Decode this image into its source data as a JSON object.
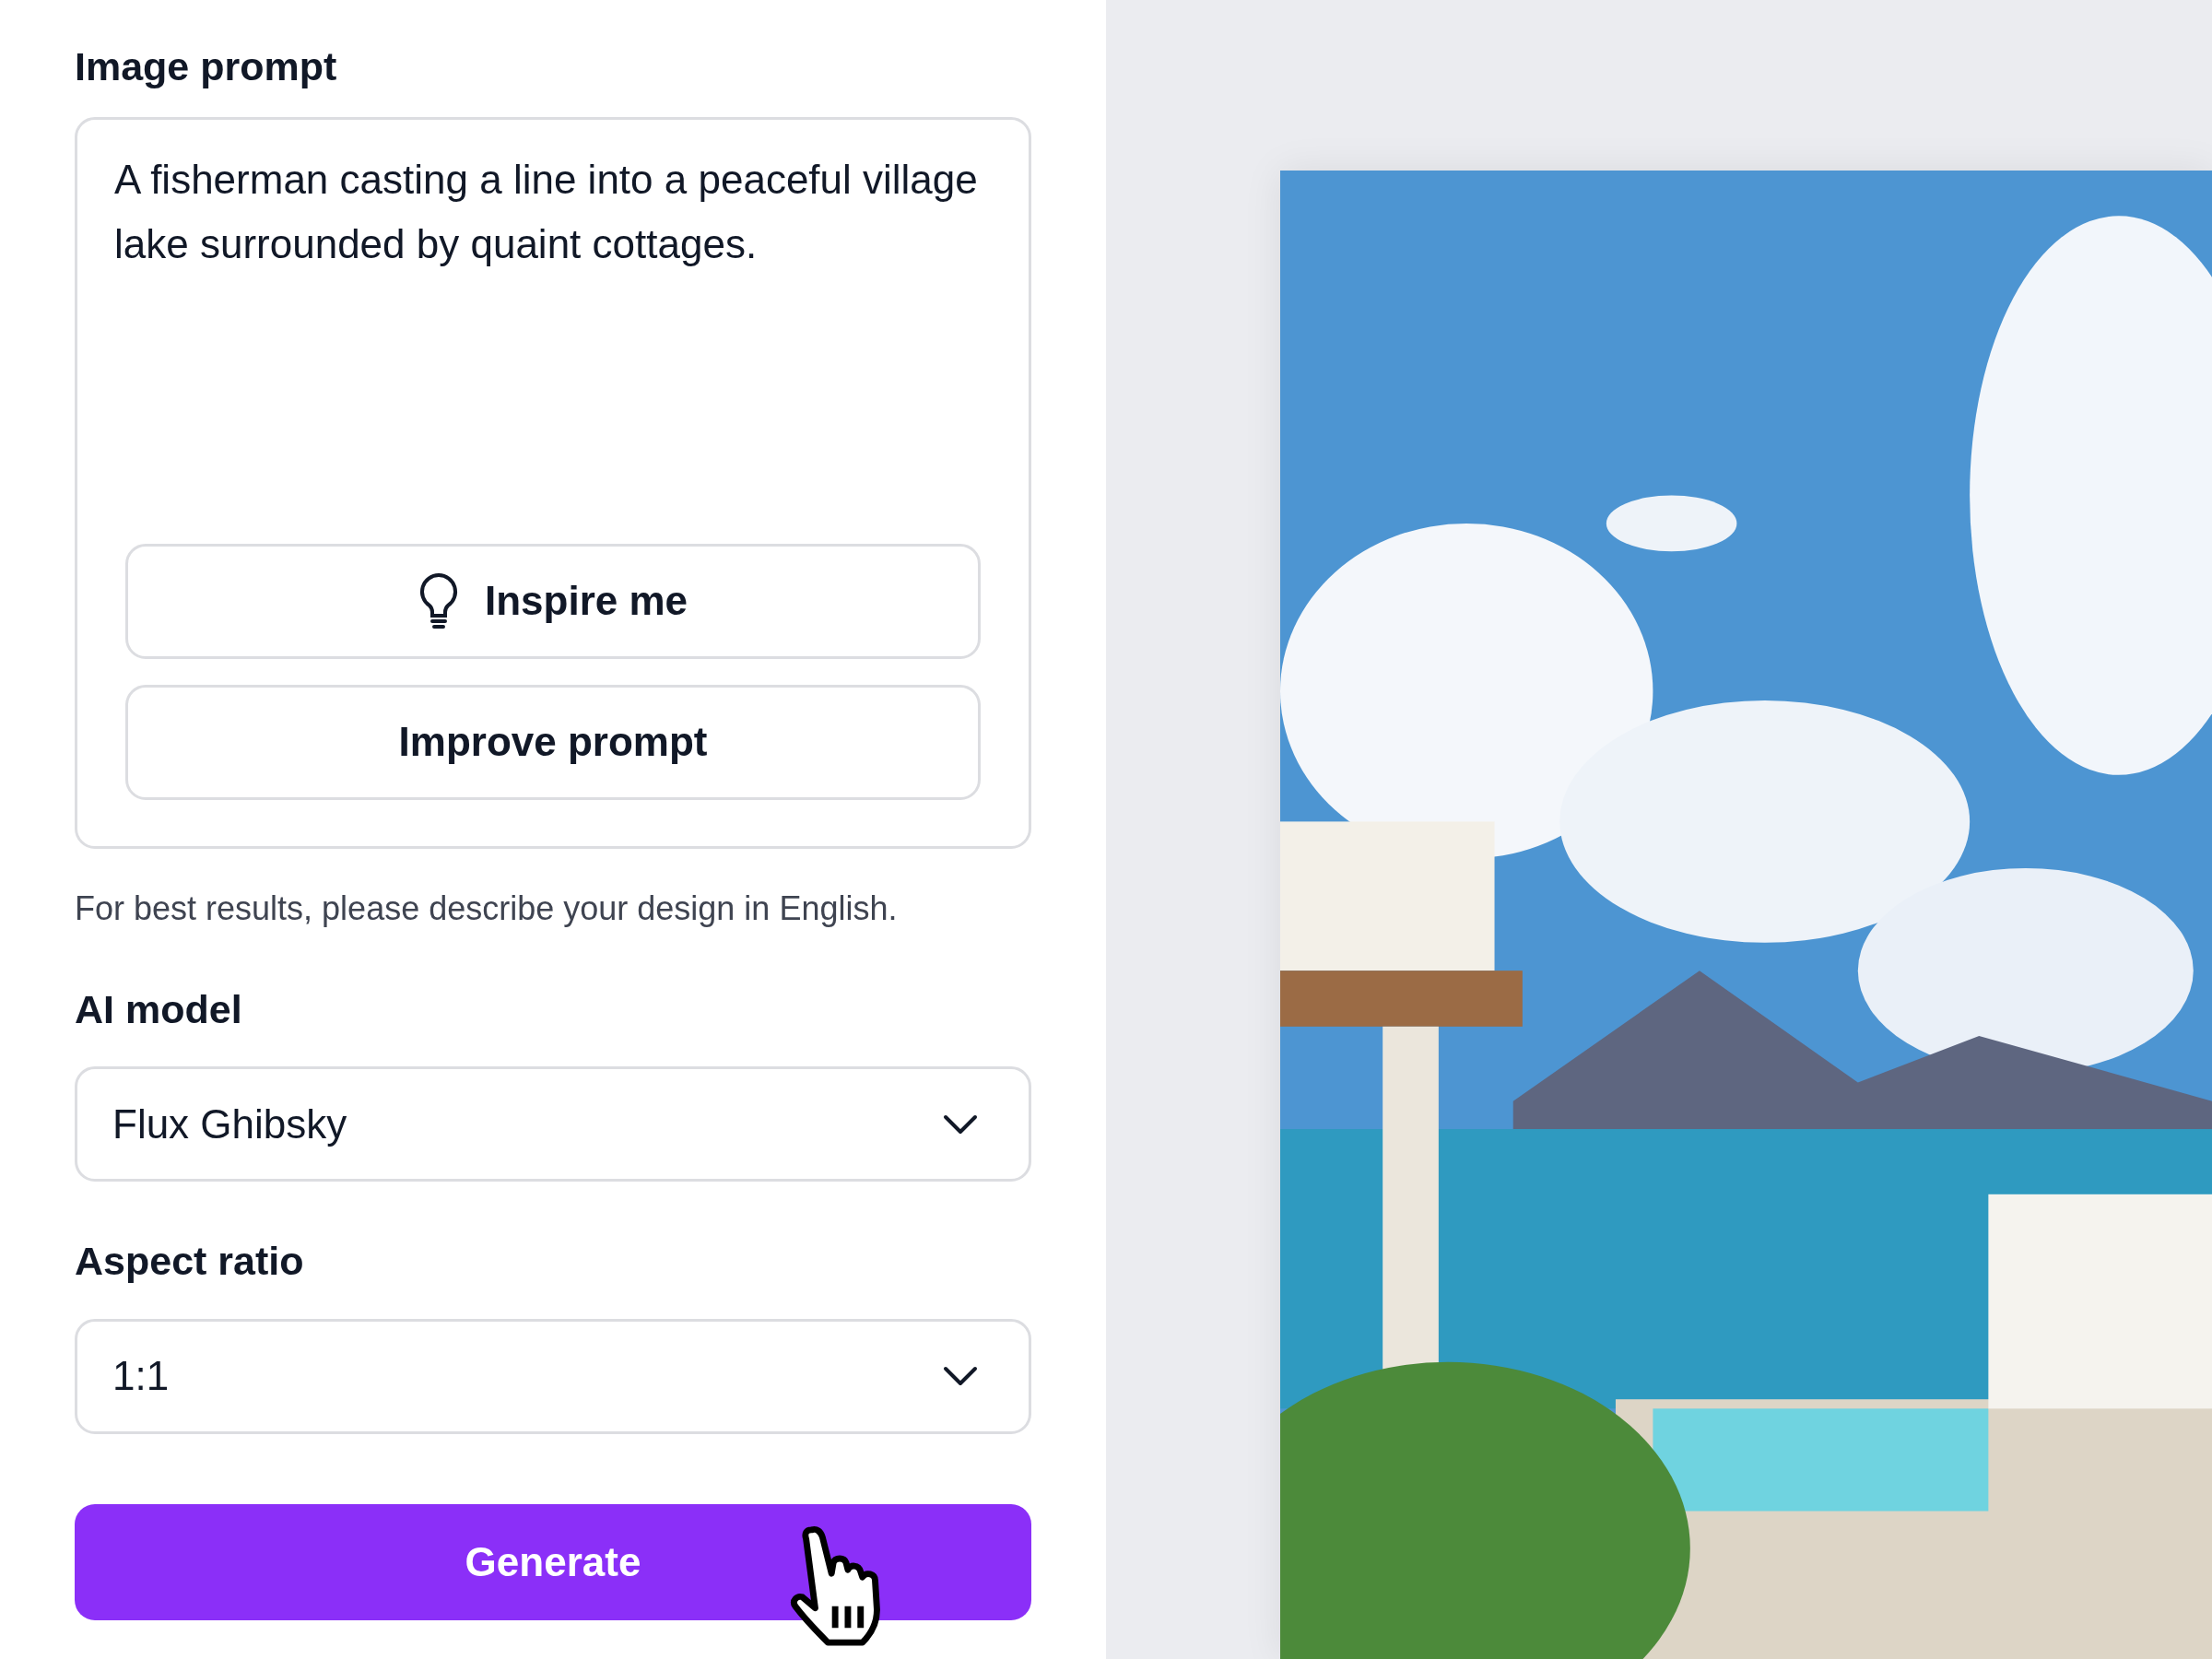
{
  "prompt_section": {
    "label": "Image prompt",
    "value": "A fisherman casting a line into a peaceful village lake surrounded by quaint cottages.",
    "buttons": [
      {
        "kind": "inspire",
        "label": "Inspire me"
      },
      {
        "kind": "improve",
        "label": "Improve prompt"
      }
    ],
    "hint": "For best results, please describe your design in English."
  },
  "selects": [
    {
      "label": "AI model",
      "value": "Flux Ghibsky"
    },
    {
      "label": "Aspect ratio",
      "value": "1:1"
    }
  ],
  "generate_button": {
    "label": "Generate"
  }
}
